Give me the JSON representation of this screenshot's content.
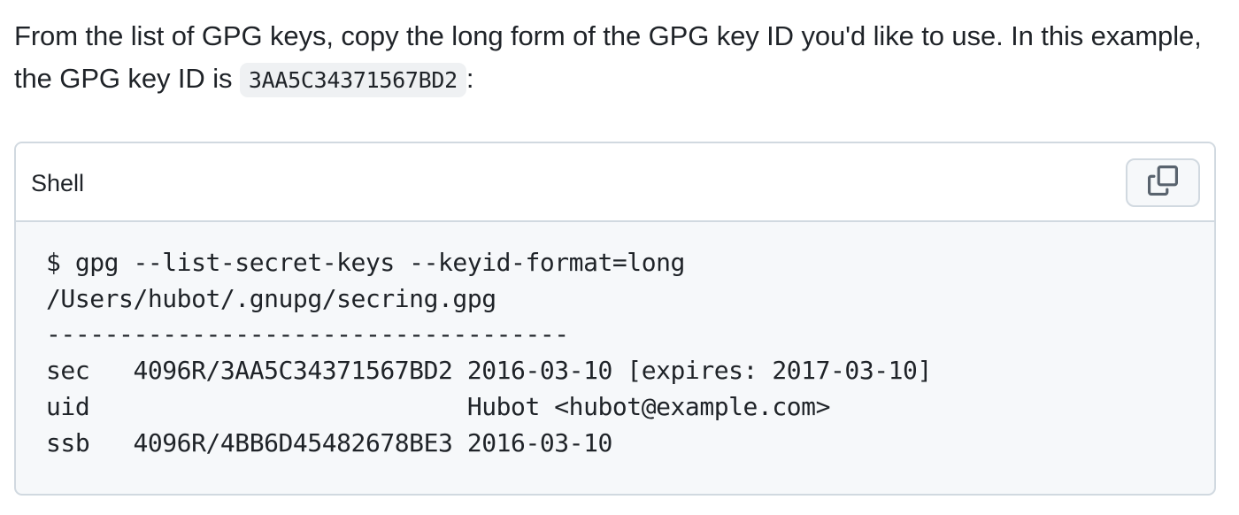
{
  "intro": {
    "text_before": "From the list of GPG keys, copy the long form of the GPG key ID you'd like to use. In this example, the GPG key ID is ",
    "key_id": "3AA5C34371567BD2",
    "text_after": ":"
  },
  "codeblock": {
    "language_label": "Shell",
    "copy_icon": "copy-icon",
    "lines": [
      "$ gpg --list-secret-keys --keyid-format=long",
      "/Users/hubot/.gnupg/secring.gpg",
      "------------------------------------",
      "sec   4096R/3AA5C34371567BD2 2016-03-10 [expires: 2017-03-10]",
      "uid                          Hubot <hubot@example.com>",
      "ssb   4096R/4BB6D45482678BE3 2016-03-10"
    ]
  },
  "colors": {
    "text": "#1f2328",
    "border": "#d1d9e0",
    "code_background": "#f6f8fa",
    "inline_code_background": "#eff1f3"
  }
}
